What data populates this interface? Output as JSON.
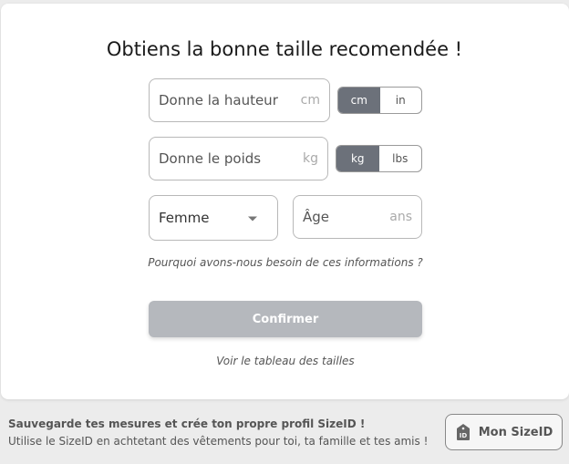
{
  "form": {
    "title": "Obtiens la bonne taille recomendée !",
    "height": {
      "placeholder": "Donne la hauteur",
      "unit": "cm",
      "units": [
        "cm",
        "in"
      ],
      "selected": "cm"
    },
    "weight": {
      "placeholder": "Donne le poids",
      "unit": "kg",
      "units": [
        "kg",
        "lbs"
      ],
      "selected": "kg"
    },
    "gender": {
      "value": "Femme"
    },
    "age": {
      "placeholder": "Âge",
      "unit": "ans"
    },
    "why_link": "Pourquoi avons-nous besoin de ces informations ?",
    "confirm_label": "Confirmer",
    "size_chart_link": "Voir le tableau des tailles"
  },
  "footer": {
    "title": "Sauvegarde tes mesures et crée ton propre profil SizeID !",
    "subtitle": "Utilise le SizeID en achtetant des vêtements pour toi, ta famille et tes amis !",
    "button_label": "Mon SizeID",
    "button_icon": "id-tag-icon"
  },
  "colors": {
    "toggle_active": "#6c717a",
    "confirm_disabled": "#b5b8bd"
  }
}
